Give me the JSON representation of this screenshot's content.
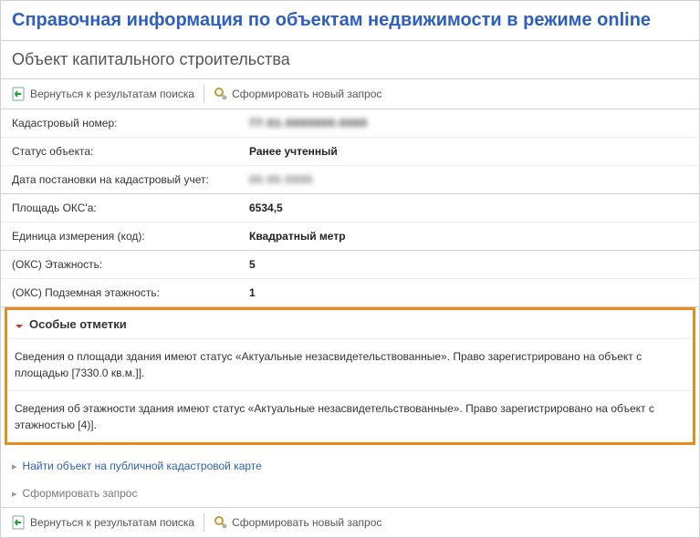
{
  "header": {
    "main_title": "Справочная информация по объектам недвижимости в режиме online",
    "sub_title": "Объект капитального строительства"
  },
  "toolbar": {
    "back_label": "Вернуться к результатам поиска",
    "new_label": "Сформировать новый запрос"
  },
  "fields": {
    "cad_num_label": "Кадастровый номер:",
    "cad_num_value": "77:01:0000000:0000",
    "status_label": "Статус объекта:",
    "status_value": "Ранее учтенный",
    "reg_date_label": "Дата постановки на кадастровый учет:",
    "reg_date_value": "00.00.0000",
    "area_label": "Площадь ОКС'a:",
    "area_value": "6534,5",
    "unit_label": "Единица измерения (код):",
    "unit_value": "Квадратный метр",
    "floors_label": "(ОКС) Этажность:",
    "floors_value": "5",
    "ufloors_label": "(ОКС) Подземная этажность:",
    "ufloors_value": "1"
  },
  "notes": {
    "header": "Особые отметки",
    "item1": "Сведения о площади здания имеют статус «Актуальные незасвидетельствованные». Право зарегистрировано на объект с площадью [7330.0 кв.м.]].",
    "item2": "Сведения об этажности здания имеют статус «Актуальные незасвидетельствованные». Право зарегистрировано на объект с этажностью [4)]."
  },
  "bottom_links": {
    "map_label": "Найти объект на публичной кадастровой карте",
    "form_label": "Сформировать запрос"
  }
}
